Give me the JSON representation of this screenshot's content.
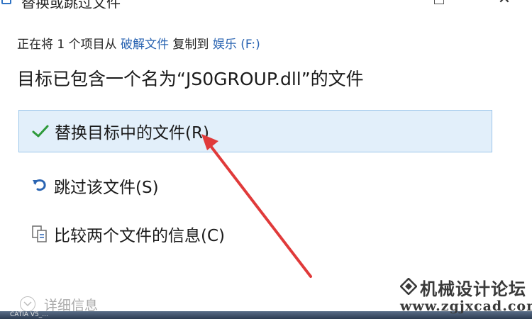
{
  "window": {
    "title": "替换或跳过文件",
    "close_glyph": "✕"
  },
  "subtitle": {
    "prefix": "正在将 1 个项目从 ",
    "source": "破解文件",
    "middle": " 复制到 ",
    "destination": "娱乐 (F:)"
  },
  "headline": "目标已包含一个名为“JS0GROUP.dll”的文件",
  "options": [
    {
      "label": "替换目标中的文件(R)",
      "icon": "checkmark-icon",
      "selected": true
    },
    {
      "label": "跳过该文件(S)",
      "icon": "skip-arrow-icon",
      "selected": false
    },
    {
      "label": "比较两个文件的信息(C)",
      "icon": "compare-files-icon",
      "selected": false
    }
  ],
  "details": {
    "label": "详细信息",
    "icon": "chevron-down-icon"
  },
  "taskbar": {
    "text": "CATIA V5_..."
  },
  "watermark": {
    "name": "机械设计论坛",
    "url": "www.zgjxcad.com"
  },
  "colors": {
    "accent": "#2a64b2",
    "selection_bg": "#e2effa",
    "selection_border": "#9cc6ea",
    "check": "#2e9a3a",
    "annotation_arrow": "#e03a3a"
  }
}
